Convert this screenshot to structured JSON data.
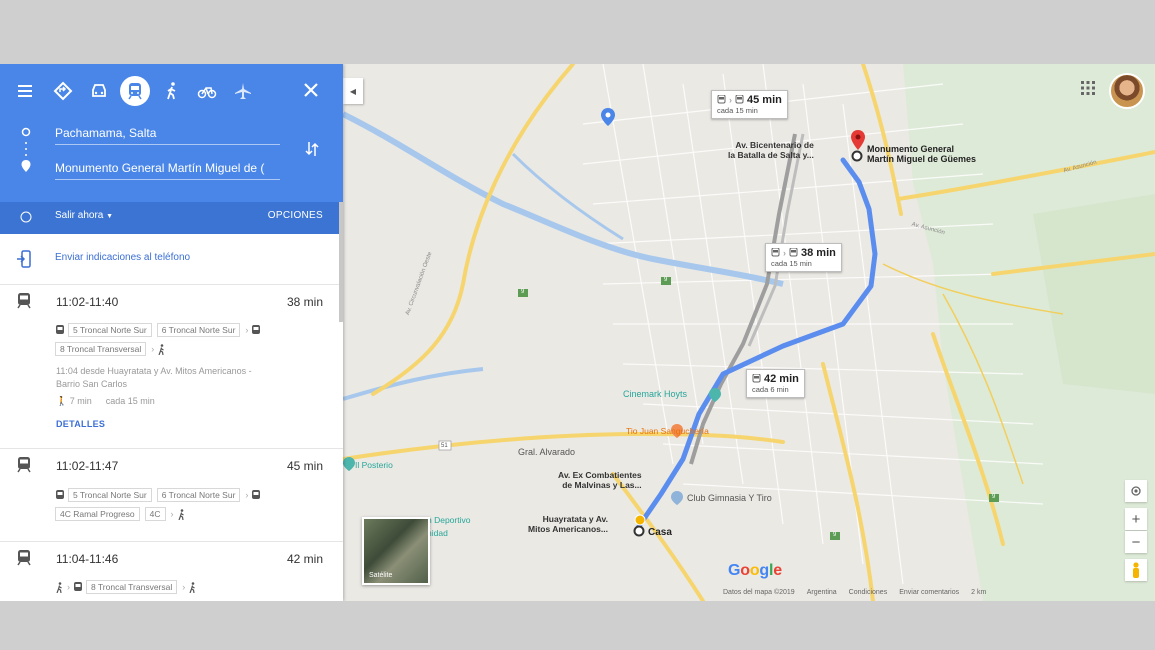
{
  "sidebar": {
    "modes": [
      "menu-icon",
      "best-route-icon",
      "car-icon",
      "transit-icon",
      "walk-icon",
      "bike-icon",
      "flight-icon"
    ],
    "origin": "Pachamama, Salta",
    "destination": "Monumento General Martín Miguel de (",
    "depart_label": "Salir ahora",
    "options_label": "OPCIONES",
    "send_label": "Enviar indicaciones al teléfono",
    "routes": [
      {
        "time": "11:02-11:40",
        "duration": "38 min",
        "line1": [
          "5 Troncal Norte Sur",
          "6 Troncal Norte Sur"
        ],
        "line2": [
          "8 Troncal Transversal"
        ],
        "info1": "11:04 desde Huayratata y Av. Mitos Americanos -",
        "info2": "Barrio San Carlos",
        "walk": "7 min",
        "freq": "cada 15 min",
        "details": "DETALLES"
      },
      {
        "time": "11:02-11:47",
        "duration": "45 min",
        "line1": [
          "5 Troncal Norte Sur",
          "6 Troncal Norte Sur"
        ],
        "line2": [
          "4C Ramal Progreso",
          "4C"
        ]
      },
      {
        "time": "11:04-11:46",
        "duration": "42 min",
        "line1": [
          "8 Troncal Transversal"
        ]
      }
    ]
  },
  "map": {
    "callouts": [
      {
        "time": "45 min",
        "freq": "cada 15 min"
      },
      {
        "time": "38 min",
        "freq": "cada 15 min"
      },
      {
        "time": "42 min",
        "freq": "cada 6 min"
      }
    ],
    "labels": {
      "dest_line1": "Monumento General",
      "dest_line2": "Martín Miguel de Güemes",
      "stop_north1": "Av. Bicentenario de",
      "stop_north2": "la Batalla de Salta y...",
      "stop_mid1": "Av. Ex Combatientes",
      "stop_mid2": "de Malvinas y Las...",
      "stop_south1": "Huayratata y Av.",
      "stop_south2": "Mitos Americanos...",
      "casa": "Casa",
      "cinemark": "Cinemark Hoyts",
      "tio_juan": "Tio Juan Sanguchería",
      "club": "Club Gimnasia Y Tiro",
      "gral_alvarado": "Gral. Alvarado",
      "posterio": "Il Posterio",
      "deportivo": "n Deportivo",
      "unidad": "nidad",
      "av_asuncion": "Av. Asunción",
      "av_asuncion2": "Av. Asunción",
      "av_circunvalacion": "Av. Circunvalación Oeste",
      "road_51": "51",
      "road_9a": "9",
      "road_9b": "9",
      "road_9c": "9",
      "road_9d": "9"
    },
    "satellite_label": "Satélite",
    "google": "Google",
    "attribution": [
      "Datos del mapa ©2019",
      "Argentina",
      "Condiciones",
      "Enviar comentarios",
      "2 km"
    ]
  },
  "colors": {
    "accent": "#4a86e8",
    "route": "#5b8def",
    "rail": "#9e9e9e",
    "river": "#9fc3e9",
    "marker": "#e53935"
  }
}
